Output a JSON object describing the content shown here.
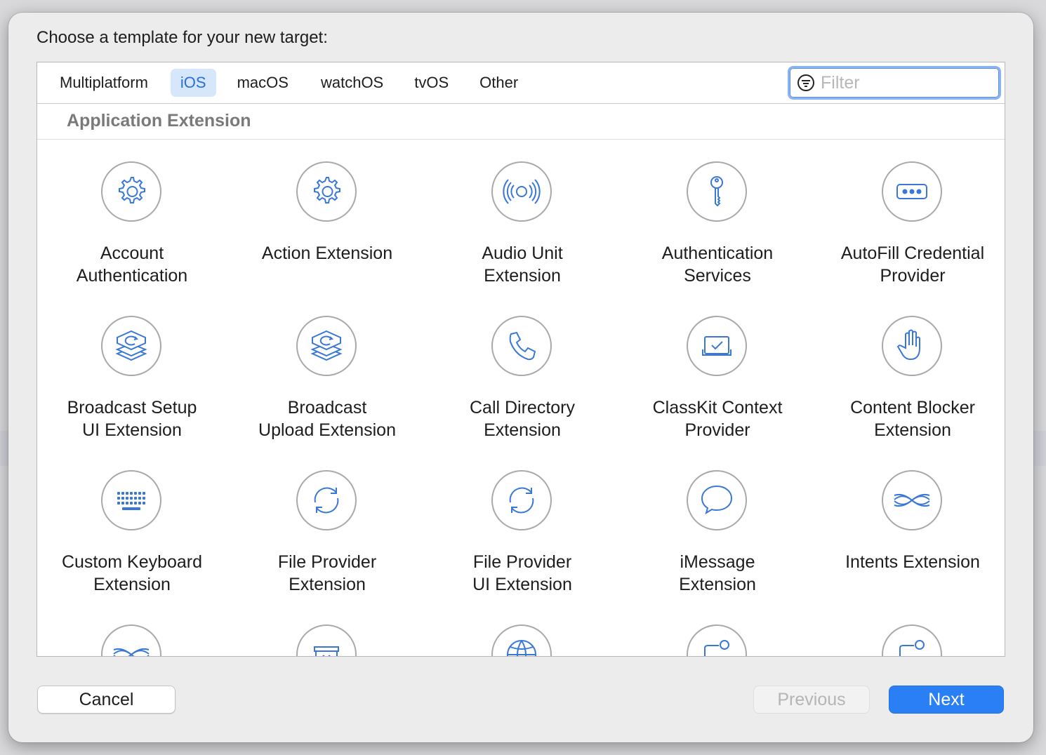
{
  "dialog": {
    "prompt": "Choose a template for your new target:",
    "tabs": [
      "Multiplatform",
      "iOS",
      "macOS",
      "watchOS",
      "tvOS",
      "Other"
    ],
    "selected_tab": "iOS",
    "filter_placeholder": "Filter",
    "section": "Application Extension",
    "accent_color": "#2a7ff5",
    "icon_color": "#3a78d8"
  },
  "templates": [
    {
      "label": "Account Authentication",
      "icon": "gear-icon"
    },
    {
      "label": "Action Extension",
      "icon": "gear-icon"
    },
    {
      "label": "Audio Unit Extension",
      "icon": "audio-waves-icon"
    },
    {
      "label": "Authentication Services",
      "icon": "key-icon"
    },
    {
      "label": "AutoFill Credential Provider",
      "icon": "password-dots-icon"
    },
    {
      "label": "Broadcast Setup UI Extension",
      "icon": "broadcast-stack-icon"
    },
    {
      "label": "Broadcast Upload Extension",
      "icon": "broadcast-stack-icon"
    },
    {
      "label": "Call Directory Extension",
      "icon": "phone-icon"
    },
    {
      "label": "ClassKit Context Provider",
      "icon": "classkit-check-icon"
    },
    {
      "label": "Content Blocker Extension",
      "icon": "raised-hand-icon"
    },
    {
      "label": "Custom Keyboard Extension",
      "icon": "keyboard-icon"
    },
    {
      "label": "File Provider Extension",
      "icon": "sync-arrows-icon"
    },
    {
      "label": "File Provider UI Extension",
      "icon": "sync-arrows-icon"
    },
    {
      "label": "iMessage Extension",
      "icon": "speech-bubble-icon"
    },
    {
      "label": "Intents Extension",
      "icon": "intents-waves-icon"
    },
    {
      "label": "",
      "icon": "intents-waves-icon"
    },
    {
      "label": "",
      "icon": "inbox-tray-icon"
    },
    {
      "label": "",
      "icon": "globe-icon"
    },
    {
      "label": "",
      "icon": "notification-frame-icon"
    },
    {
      "label": "",
      "icon": "notification-frame-icon"
    }
  ],
  "buttons": {
    "cancel": "Cancel",
    "previous": "Previous",
    "next": "Next"
  }
}
